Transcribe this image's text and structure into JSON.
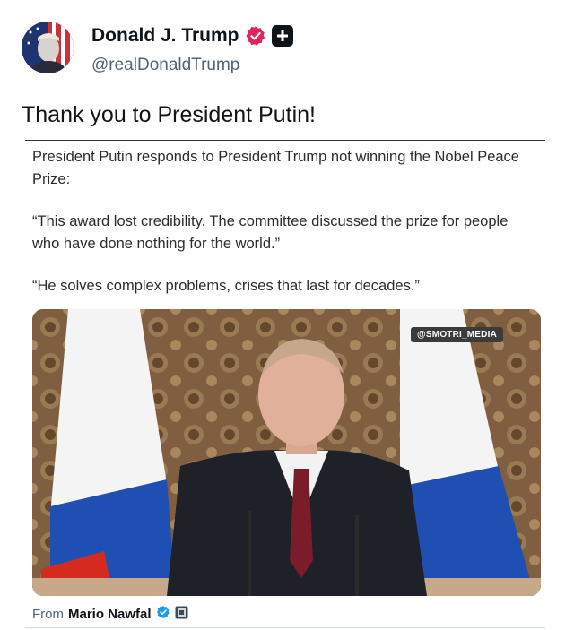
{
  "author": {
    "display_name": "Donald J. Trump",
    "handle": "@realDonaldTrump",
    "verified_icon": "verified-badge-icon",
    "affiliation_icon": "affiliation-plus-icon"
  },
  "post": {
    "text": "Thank you to President Putin!"
  },
  "quote": {
    "paragraph_1": "President Putin responds to President Trump not winning the Nobel Peace Prize:",
    "paragraph_2": "“This award lost credibility. The committee discussed the prize for people who have done nothing for the world.”",
    "paragraph_3": "“He solves complex problems, crises that last for decades.”",
    "media_watermark": "@SMOTRI_MEDIA",
    "source_prefix": "From",
    "source_name": "Mario Nawfal"
  },
  "colors": {
    "verified_badge": "#e0245e",
    "flag_white": "#f4f4f4",
    "flag_blue": "#1f4fb3",
    "flag_red": "#d52b1e"
  }
}
